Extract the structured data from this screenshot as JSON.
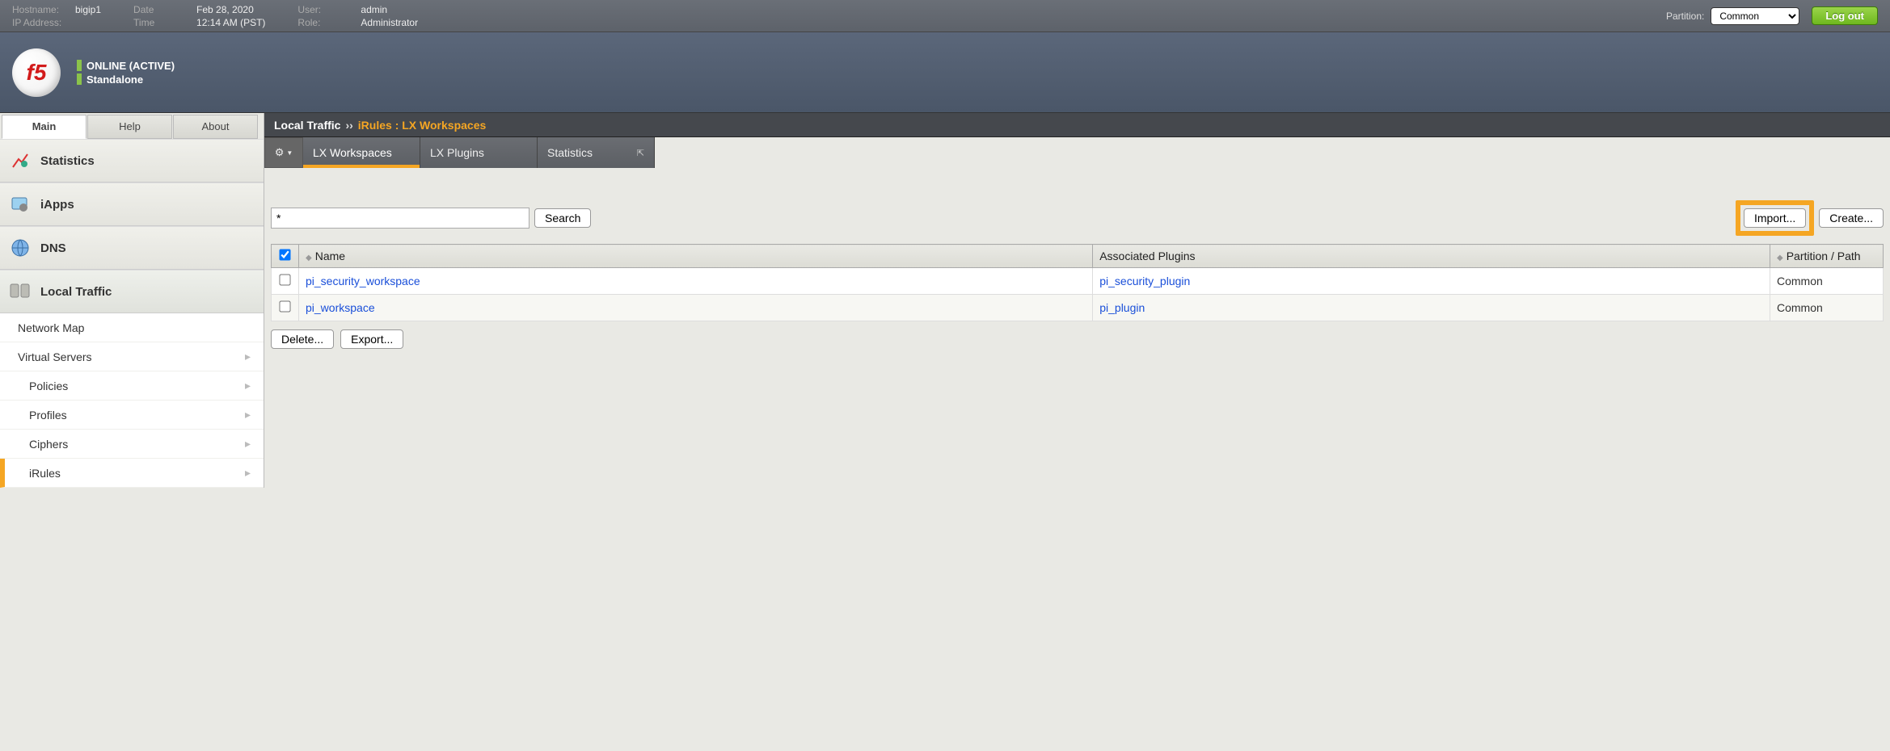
{
  "topbar": {
    "hostname_label": "Hostname:",
    "hostname": "bigip1",
    "ip_label": "IP Address:",
    "ip_value": "",
    "date_label": "Date",
    "date": "Feb 28, 2020",
    "time_label": "Time",
    "time": "12:14 AM (PST)",
    "user_label": "User:",
    "user": "admin",
    "role_label": "Role:",
    "role": "Administrator",
    "partition_label": "Partition:",
    "partition_selected": "Common",
    "logout": "Log out"
  },
  "header": {
    "status1": "ONLINE (ACTIVE)",
    "status2": "Standalone"
  },
  "navtabs": {
    "main": "Main",
    "help": "Help",
    "about": "About"
  },
  "sidebar": {
    "statistics": "Statistics",
    "iapps": "iApps",
    "dns": "DNS",
    "local_traffic": "Local Traffic",
    "items": [
      {
        "label": "Network Map"
      },
      {
        "label": "Virtual Servers"
      },
      {
        "label": "Policies"
      },
      {
        "label": "Profiles"
      },
      {
        "label": "Ciphers"
      },
      {
        "label": "iRules"
      }
    ]
  },
  "crumb": {
    "root": "Local Traffic",
    "sep": "››",
    "leaf": "iRules : LX Workspaces"
  },
  "subtabs": {
    "lxw": "LX Workspaces",
    "lxp": "LX Plugins",
    "stats": "Statistics"
  },
  "search": {
    "value": "*",
    "button": "Search",
    "import": "Import...",
    "create": "Create..."
  },
  "table": {
    "col_name": "Name",
    "col_plugins": "Associated Plugins",
    "col_partition": "Partition / Path",
    "rows": [
      {
        "name": "pi_security_workspace",
        "plugin": "pi_security_plugin",
        "partition": "Common"
      },
      {
        "name": "pi_workspace",
        "plugin": "pi_plugin",
        "partition": "Common"
      }
    ]
  },
  "actions": {
    "delete": "Delete...",
    "export": "Export..."
  }
}
